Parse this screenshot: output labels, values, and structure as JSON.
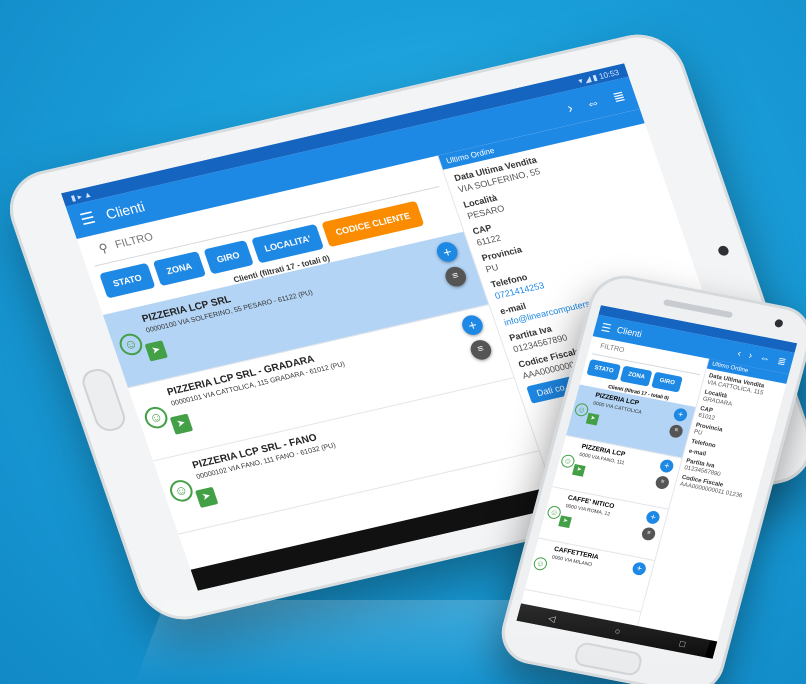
{
  "tablet": {
    "appbar": {
      "title": "Clienti",
      "menu_icon": "menu-icon",
      "actions": [
        "chevron-right-icon",
        "swap-icon",
        "filter-list-icon"
      ]
    },
    "search": {
      "placeholder": "FILTRO"
    },
    "filters": [
      "STATO",
      "ZONA",
      "GIRO",
      "LOCALITA'",
      "CODICE CLIENTE"
    ],
    "counter": "Clienti (filtrati 17 - totali 0)",
    "rows": [
      {
        "name": "PIZZERIA LCP  SRL",
        "address": "00000100  VIA SOLFERINO, 55 PESARO - 61122 (PU)",
        "selected": true
      },
      {
        "name": "PIZZERIA LCP SRL - GRADARA",
        "address": "00000101  VIA CATTOLICA, 115 GRADARA - 61012 (PU)",
        "selected": false
      },
      {
        "name": "PIZZERIA LCP SRL - FANO",
        "address": "00000102  VIA FANO, 111 FANO - 61032 (PU)",
        "selected": false
      }
    ],
    "detail": {
      "header": "Ultimo Ordine",
      "fields": [
        {
          "label": "Data Ultima Vendita",
          "value": "VIA SOLFERINO, 55"
        },
        {
          "label": "Località",
          "value": "PESARO"
        },
        {
          "label": "CAP",
          "value": "61122"
        },
        {
          "label": "Provincia",
          "value": "PU"
        },
        {
          "label": "Telefono",
          "value": "0721414253"
        },
        {
          "label": "e-mail",
          "value": "info@linearcomputers.com"
        },
        {
          "label": "Partita Iva",
          "value": "01234567890"
        },
        {
          "label": "Codice Fiscale",
          "value": "AAA0000000"
        }
      ],
      "button": "Dati co..."
    }
  },
  "phone": {
    "appbar": {
      "title": "Clienti"
    },
    "search": {
      "placeholder": "FILTRO"
    },
    "filters": [
      "STATO",
      "ZONA",
      "GIRO"
    ],
    "counter": "Clienti (filtrati 17 - totali 0)",
    "rows": [
      {
        "name": "PIZZERIA LCP",
        "address": "0000  VIA CATTOLICA",
        "selected": true
      },
      {
        "name": "PIZZERIA LCP",
        "address": "0000  VIA FANO, 111",
        "selected": false
      },
      {
        "name": "CAFFE' NITICO",
        "address": "0000  VIA ROMA, 12",
        "selected": false
      },
      {
        "name": "CAFFETTERIA",
        "address": "0000  VIA MILANO",
        "selected": false
      }
    ],
    "detail": {
      "header": "Ultimo Ordine",
      "fields": [
        {
          "label": "Data Ultima Vendita",
          "value": "VIA CATTOLICA, 115"
        },
        {
          "label": "Località",
          "value": "GRADARA"
        },
        {
          "label": "CAP",
          "value": "61012"
        },
        {
          "label": "Provincia",
          "value": "PU"
        },
        {
          "label": "Telefono",
          "value": ""
        },
        {
          "label": "e-mail",
          "value": ""
        },
        {
          "label": "Partita Iva",
          "value": "01234567890"
        },
        {
          "label": "Codice Fiscale",
          "value": "AAA0000000011 01236"
        }
      ]
    }
  },
  "colors": {
    "background": "#1a9fdb",
    "primary": "#1e88e5",
    "accent": "#fb8c00",
    "success": "#43a047",
    "selected_row": "#b3d4f5"
  }
}
